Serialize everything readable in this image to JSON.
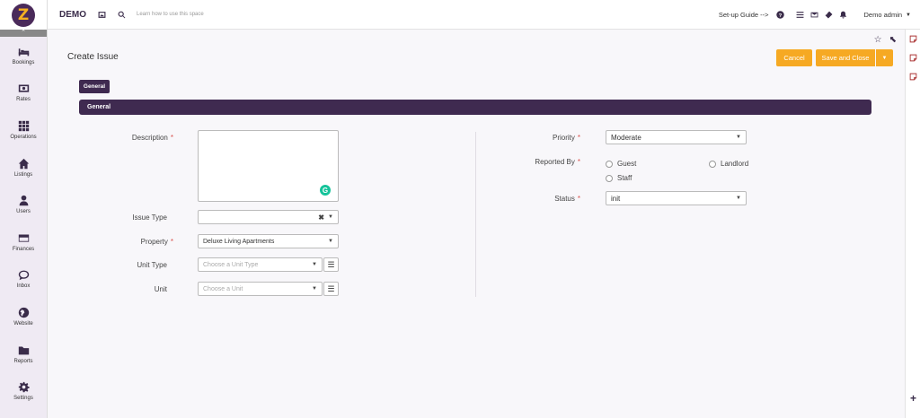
{
  "app": {
    "brand": "DEMO",
    "logo_letter": "Z",
    "learn_link": "Learn how to use this space"
  },
  "topbar": {
    "setup_guide": "Set-up Guide -->",
    "user": "Demo admin"
  },
  "sidebar": {
    "items": [
      {
        "label": "Bookings",
        "icon": "bed-icon"
      },
      {
        "label": "Rates",
        "icon": "money-icon"
      },
      {
        "label": "Operations",
        "icon": "grid-icon"
      },
      {
        "label": "Listings",
        "icon": "home-icon"
      },
      {
        "label": "Users",
        "icon": "user-icon"
      },
      {
        "label": "Finances",
        "icon": "card-icon"
      },
      {
        "label": "Inbox",
        "icon": "chat-icon"
      },
      {
        "label": "Website",
        "icon": "globe-icon"
      },
      {
        "label": "Reports",
        "icon": "folder-icon"
      },
      {
        "label": "Settings",
        "icon": "gear-icon"
      }
    ]
  },
  "page": {
    "title": "Create Issue",
    "cancel_label": "Cancel",
    "save_label": "Save and Close",
    "tab_label": "General",
    "section_title": "General"
  },
  "form": {
    "description": {
      "label": "Description",
      "value": ""
    },
    "issue_type": {
      "label": "Issue Type",
      "value": ""
    },
    "property": {
      "label": "Property",
      "value": "Deluxe Living Apartments"
    },
    "unit_type": {
      "label": "Unit Type",
      "placeholder": "Choose a Unit Type"
    },
    "unit": {
      "label": "Unit",
      "placeholder": "Choose a Unit"
    },
    "priority": {
      "label": "Priority",
      "value": "Moderate"
    },
    "reported_by": {
      "label": "Reported By",
      "options": [
        "Guest",
        "Landlord",
        "Staff"
      ]
    },
    "status": {
      "label": "Status",
      "value": "init"
    }
  },
  "colors": {
    "primary": "#3f2a50",
    "accent": "#f6a923",
    "required": "#d9534f"
  }
}
